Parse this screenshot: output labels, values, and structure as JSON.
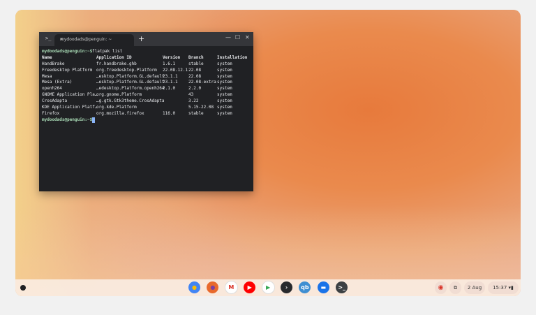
{
  "terminal": {
    "tab_title": "mydoodads@penguin: ~",
    "prompt": "mydoodads@penguin:~$",
    "command": "flatpak list",
    "headers": [
      "Name",
      "Application ID",
      "Version",
      "Branch",
      "Installation"
    ],
    "rows": [
      [
        "HandBrake",
        "fr.handbrake.ghb",
        "1.6.1",
        "stable",
        "system"
      ],
      [
        "Freedesktop Platform",
        "org.freedesktop.Platform",
        "22.08.12.1",
        "22.08",
        "system"
      ],
      [
        "Mesa",
        "…esktop.Platform.GL.default",
        "23.1.1",
        "22.08",
        "system"
      ],
      [
        "Mesa (Extra)",
        "…esktop.Platform.GL.default",
        "23.1.1",
        "22.08-extra",
        "system"
      ],
      [
        "openh264",
        "…edesktop.Platform.openh264",
        "2.1.0",
        "2.2.0",
        "system"
      ],
      [
        "GNOME Application Pla…",
        "org.gnome.Platform",
        "",
        "43",
        "system"
      ],
      [
        "CrosAdapta",
        "…g.gtk.Gtk3theme.CrosAdapta",
        "",
        "3.22",
        "system"
      ],
      [
        "KDE Application Platf…",
        "org.kde.Platform",
        "",
        "5.15-22.08",
        "system"
      ],
      [
        "Firefox",
        "org.mozilla.firefox",
        "116.0",
        "stable",
        "system"
      ]
    ]
  },
  "shelf": {
    "apps": [
      {
        "name": "chrome-icon",
        "color": "#4285f4"
      },
      {
        "name": "firefox-icon",
        "color": "#e8692c"
      },
      {
        "name": "gmail-icon",
        "color": "#ffffff"
      },
      {
        "name": "youtube-icon",
        "color": "#ff0000"
      },
      {
        "name": "play-store-icon",
        "color": "#ffffff"
      },
      {
        "name": "plex-icon",
        "color": "#282a2d"
      },
      {
        "name": "qbittorrent-icon",
        "color": "#3f8fd2"
      },
      {
        "name": "files-icon",
        "color": "#1a73e8"
      },
      {
        "name": "terminal-icon",
        "color": "#3c4043"
      }
    ],
    "date": "2 Aug",
    "time": "15:37"
  }
}
